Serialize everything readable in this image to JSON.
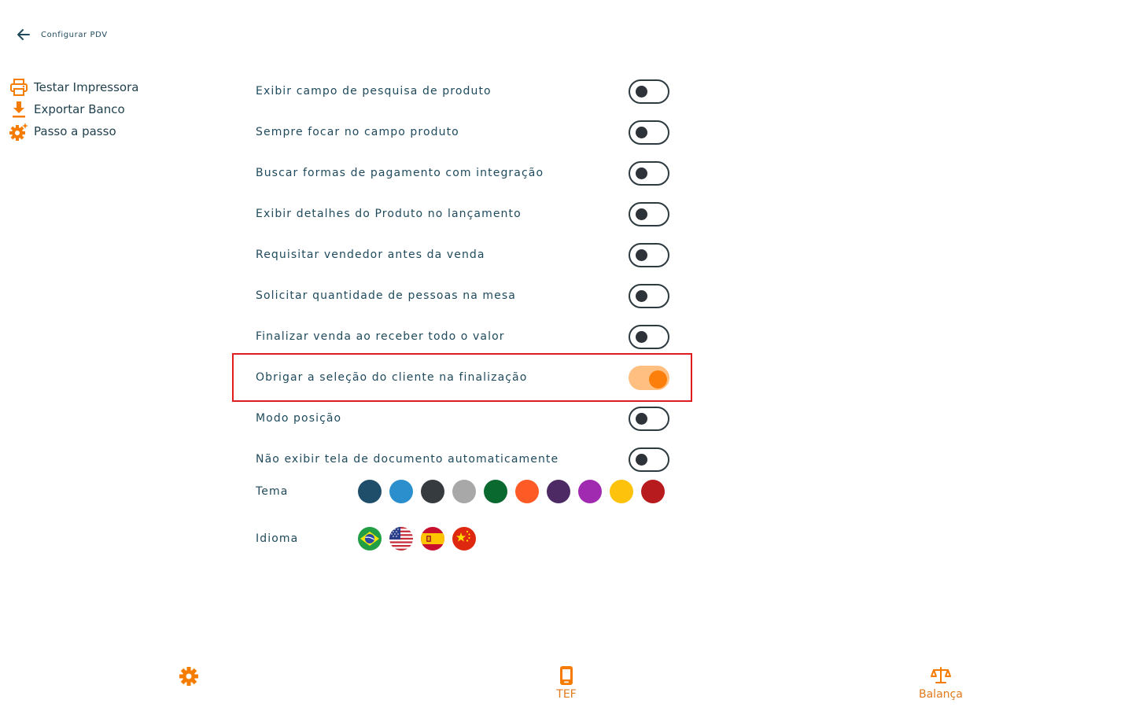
{
  "header": {
    "title": "Configurar PDV",
    "back_icon": "arrow-left-icon"
  },
  "sidebar": {
    "items": [
      {
        "label": "Testar Impressora",
        "icon": "printer-icon"
      },
      {
        "label": "Exportar Banco",
        "icon": "download-icon"
      },
      {
        "label": "Passo a passo",
        "icon": "gear-sparkle-icon"
      }
    ]
  },
  "settings": {
    "options": [
      {
        "label": "Exibir campo de pesquisa de produto",
        "enabled": false
      },
      {
        "label": "Sempre focar no campo produto",
        "enabled": false
      },
      {
        "label": "Buscar formas de pagamento com integração",
        "enabled": false
      },
      {
        "label": "Exibir detalhes do Produto no lançamento",
        "enabled": false
      },
      {
        "label": "Requisitar vendedor antes da venda",
        "enabled": false
      },
      {
        "label": "Solicitar quantidade de pessoas na mesa",
        "enabled": false
      },
      {
        "label": "Finalizar venda ao receber todo o valor",
        "enabled": false
      },
      {
        "label": "Obrigar a seleção do cliente na finalização",
        "enabled": true
      },
      {
        "label": "Modo posição",
        "enabled": false
      },
      {
        "label": "Não exibir tela de documento automaticamente",
        "enabled": false
      }
    ]
  },
  "theme": {
    "label": "Tema",
    "colors": [
      "#1f4e6b",
      "#2a8fcc",
      "#363b40",
      "#a8a8a8",
      "#09692f",
      "#fd5a25",
      "#4d2a64",
      "#a12bb0",
      "#fdc20c",
      "#b81b1e"
    ]
  },
  "language": {
    "label": "Idioma",
    "flags": [
      "brazil-flag-icon",
      "usa-flag-icon",
      "spain-flag-icon",
      "china-flag-icon"
    ]
  },
  "bottom_nav": {
    "items": [
      {
        "label": "",
        "icon": "gear-icon"
      },
      {
        "label": "TEF",
        "icon": "phone-icon"
      },
      {
        "label": "Balança",
        "icon": "scale-icon"
      }
    ]
  },
  "colors": {
    "accent": "#fb7f0a",
    "text": "#1f4a5c",
    "highlight_border": "#e01b1b"
  }
}
